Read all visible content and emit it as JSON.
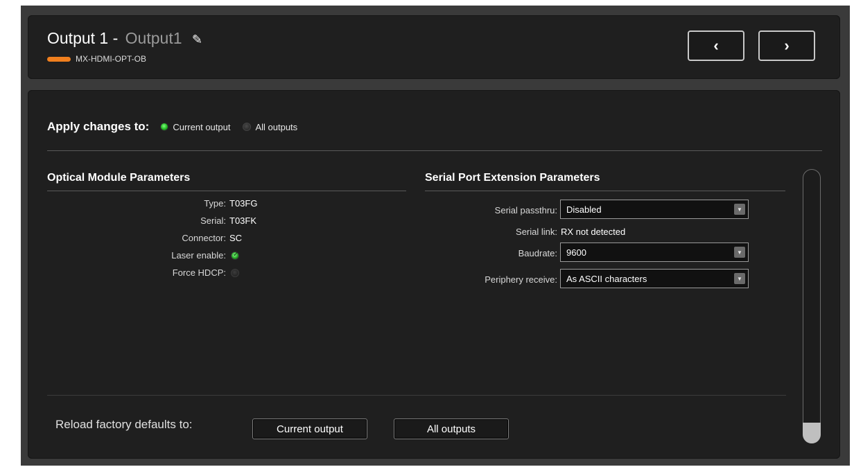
{
  "header": {
    "output_prefix": "Output 1 -",
    "output_name": "Output1",
    "edit_icon": "pencil-icon",
    "device_model": "MX-HDMI-OPT-OB",
    "device_color": "#f07f1e",
    "prev_label": "‹",
    "next_label": "›"
  },
  "apply": {
    "label": "Apply changes to:",
    "options": [
      {
        "label": "Current output",
        "selected": true
      },
      {
        "label": "All outputs",
        "selected": false
      }
    ]
  },
  "optical": {
    "title": "Optical Module Parameters",
    "type_label": "Type:",
    "type_value": "T03FG",
    "serial_label": "Serial:",
    "serial_value": "T03FK",
    "connector_label": "Connector:",
    "connector_value": "SC",
    "laser_label": "Laser enable:",
    "laser_enabled": true,
    "hdcp_label": "Force HDCP:",
    "hdcp_enabled": false
  },
  "serial": {
    "title": "Serial Port Extension Parameters",
    "passthru_label": "Serial passthru:",
    "passthru_value": "Disabled",
    "link_label": "Serial link:",
    "link_value": "RX not detected",
    "baud_label": "Baudrate:",
    "baud_value": "9600",
    "periphery_label": "Periphery receive:",
    "periphery_value": "As ASCII characters"
  },
  "reload": {
    "label": "Reload factory defaults to:",
    "current_button": "Current output",
    "all_button": "All outputs"
  },
  "colors": {
    "accent_green": "#22b522",
    "device_orange": "#f07f1e",
    "panel_bg": "#1f1f1f"
  }
}
